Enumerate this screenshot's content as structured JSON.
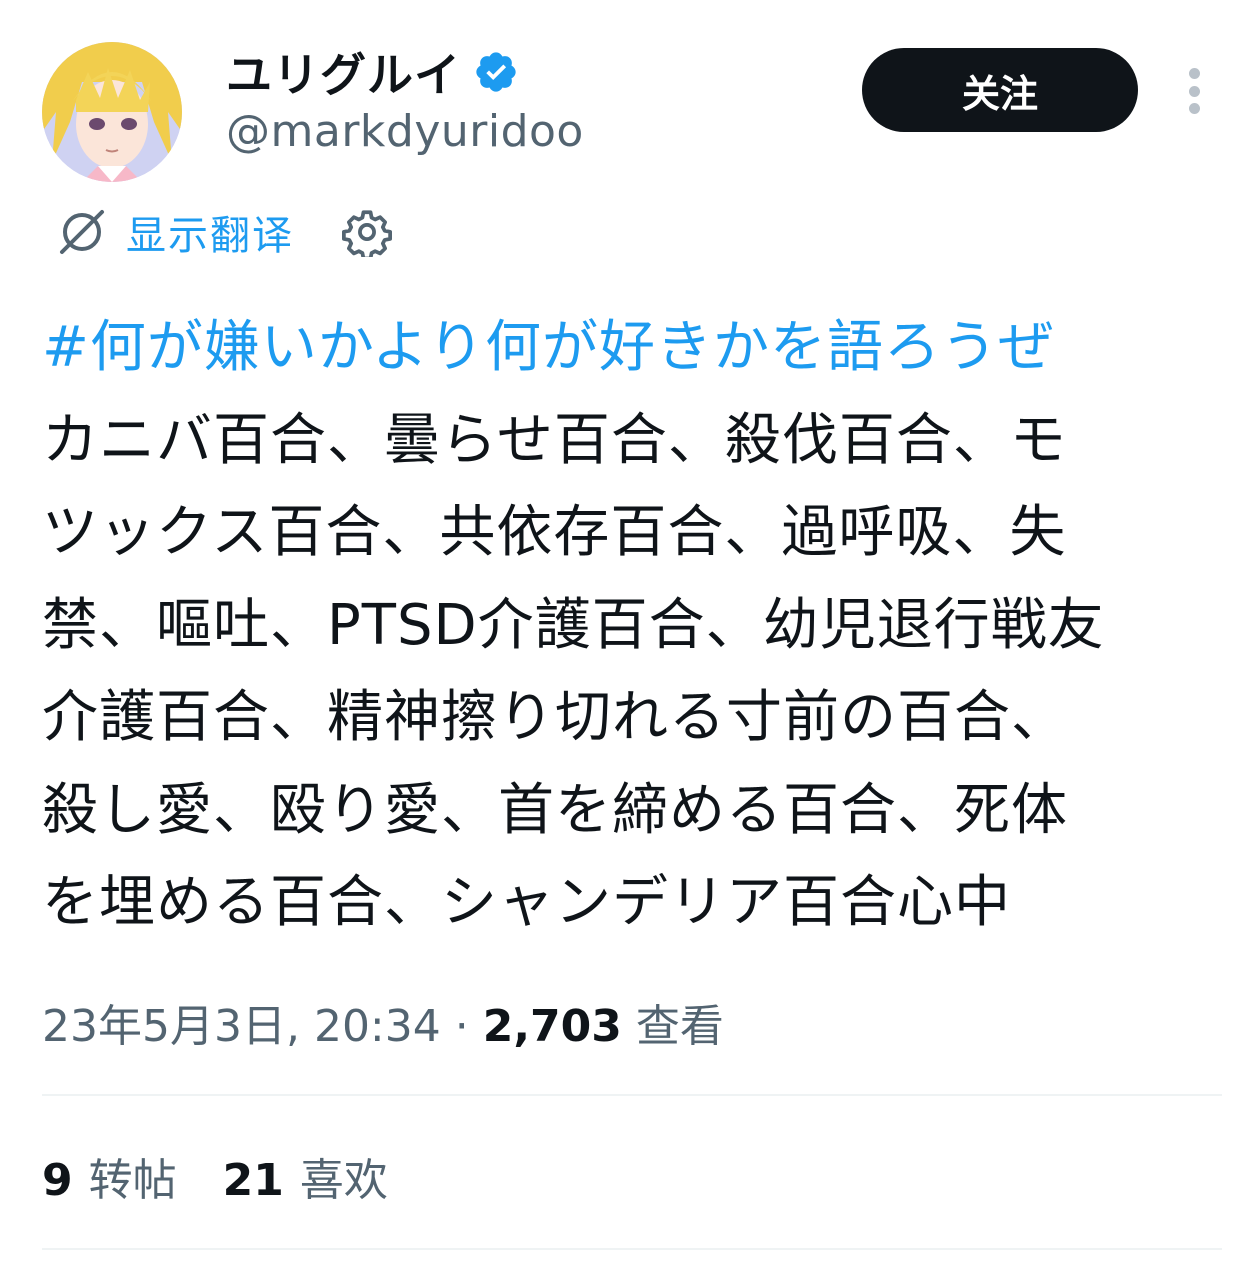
{
  "user": {
    "display_name": "ユリグルイ",
    "handle": "@markdyuridoo",
    "verified": true
  },
  "follow_button_label": "关注",
  "translate": {
    "label": "显示翻译"
  },
  "tweet": {
    "hashtag": "#何が嫌いかより何が好きかを語ろうぜ",
    "lines": [
      "カニバ百合、曇らせ百合、殺伐百合、モ",
      "ツックス百合、共依存百合、過呼吸、失",
      "禁、嘔吐、PTSD介護百合、幼児退行戦友",
      "介護百合、精神擦り切れる寸前の百合、",
      "殺し愛、殴り愛、首を締める百合、死体",
      "を埋める百合、シャンデリア百合心中"
    ]
  },
  "meta": {
    "timestamp": "23年5月3日, 20:34",
    "separator": " · ",
    "views_count": "2,703",
    "views_label": "查看"
  },
  "stats": {
    "reposts_count": "9",
    "reposts_label": "转帖",
    "likes_count": "21",
    "likes_label": "喜欢"
  },
  "colors": {
    "accent": "#1d9bf0",
    "text_primary": "#0f1419",
    "text_secondary": "#536471",
    "button_bg": "#0f1419"
  }
}
